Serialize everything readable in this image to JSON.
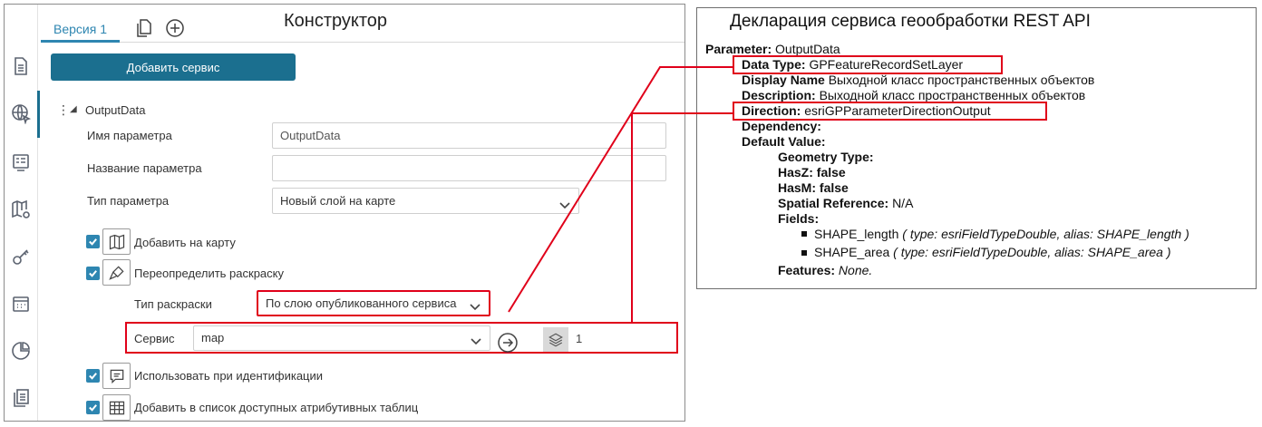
{
  "app": {
    "title": "Конструктор",
    "tab_label": "Версия 1",
    "add_service_label": "Добавить сервис",
    "node_label": "OutputData",
    "fields": {
      "param_name_label": "Имя параметра",
      "param_name_value": "OutputData",
      "param_title_label": "Название параметра",
      "param_title_value": "",
      "param_type_label": "Тип параметра",
      "param_type_value": "Новый слой на карте"
    },
    "checkboxes": [
      {
        "label": "Добавить на карту",
        "checked": true,
        "icon": "map-icon"
      },
      {
        "label": "Переопределить раскраску",
        "checked": true,
        "icon": "brush-icon"
      },
      {
        "label": "Использовать при идентификации",
        "checked": true,
        "icon": "identify-icon"
      },
      {
        "label": "Добавить в список доступных атрибутивных таблиц",
        "checked": true,
        "icon": "table-icon"
      }
    ],
    "coloring": {
      "label": "Тип раскраски",
      "value": "По слою опубликованного сервиса"
    },
    "service": {
      "label": "Сервис",
      "value": "map",
      "layer_count": "1"
    },
    "rail_icons": [
      "document-icon",
      "globe-cursor-icon",
      "list-card-icon",
      "map-settings-icon",
      "key-icon",
      "calendar-icon",
      "pie-chart-icon",
      "pages-icon"
    ],
    "accent_color": "#1b6f8f",
    "highlight_color": "#e0001a"
  },
  "declaration": {
    "title": "Декларация сервиса геообработки REST API",
    "parameter_key": "Parameter:",
    "parameter_value": "OutputData",
    "data_type_key": "Data Type:",
    "data_type_value": "GPFeatureRecordSetLayer",
    "display_name_key": "Display Name",
    "display_name_value": "Выходной класс пространственных объектов",
    "description_key": "Description:",
    "description_value": "Выходной класс пространственных объектов",
    "direction_key": "Direction:",
    "direction_value": "esriGPParameterDirectionOutput",
    "dependency_key": "Dependency:",
    "default_value_key": "Default Value:",
    "geometry_type_key": "Geometry Type:",
    "hasz_key": "HasZ:",
    "hasz_value": "false",
    "hasm_key": "HasM:",
    "hasm_value": "false",
    "spatial_ref_key": "Spatial Reference:",
    "spatial_ref_value": "N/A",
    "fields_key": "Fields:",
    "fields": [
      {
        "name": "SHAPE_length",
        "detail": "( type: esriFieldTypeDouble, alias: SHAPE_length )"
      },
      {
        "name": "SHAPE_area",
        "detail": "( type: esriFieldTypeDouble, alias: SHAPE_area )"
      }
    ],
    "features_key": "Features:",
    "features_value": "None."
  }
}
